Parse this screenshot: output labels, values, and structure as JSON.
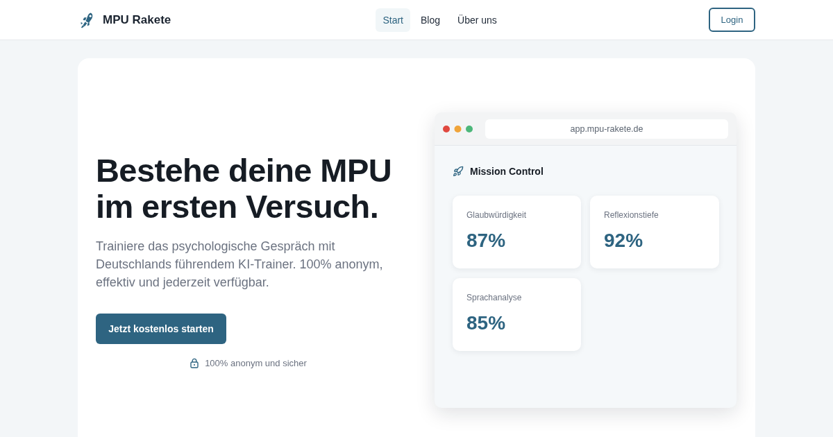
{
  "header": {
    "brand": "MPU Rakete",
    "nav": [
      {
        "label": "Start",
        "selected": true
      },
      {
        "label": "Blog",
        "selected": false
      },
      {
        "label": "Über uns",
        "selected": false
      }
    ],
    "login": "Login"
  },
  "hero": {
    "title": "Bestehe deine MPU im ersten Versuch.",
    "text": "Trainiere das psychologische Gespräch mit Deutschlands führendem KI-Trainer. 100% anonym, effektiv und jederzeit verfügbar.",
    "cta": "Jetzt kostenlos starten",
    "note": "100% anonym und sicher"
  },
  "browser": {
    "url": "app.mpu-rakete.de",
    "heading": "Mission Control",
    "stats": [
      {
        "label": "Glaubwürdigkeit",
        "value": "87%"
      },
      {
        "label": "Reflexionstiefe",
        "value": "92%"
      },
      {
        "label": "Sprachanalyse",
        "value": "85%"
      }
    ]
  }
}
